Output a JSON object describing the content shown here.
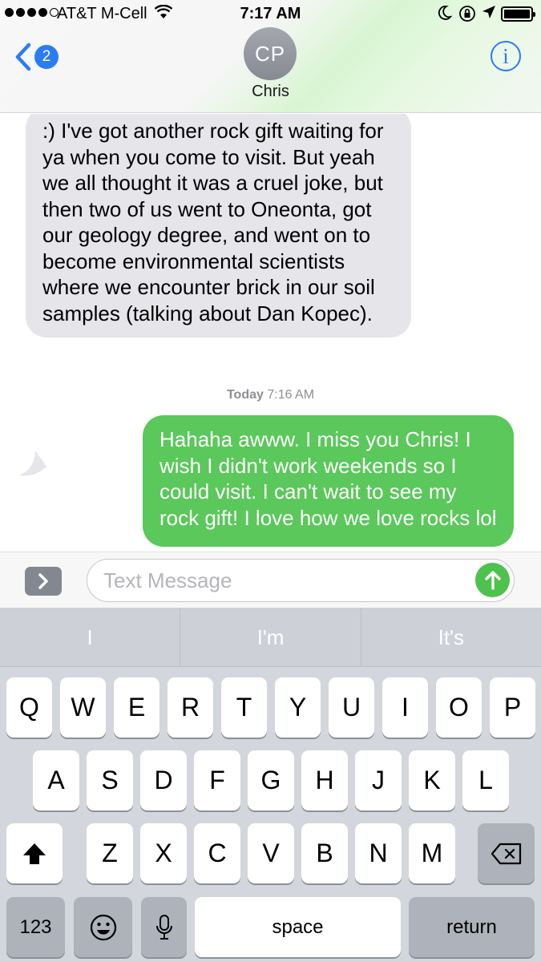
{
  "status_bar": {
    "carrier": "AT&T M-Cell",
    "time": "7:17 AM",
    "signal_bars_filled": 4,
    "signal_bars_total": 5,
    "battery_level": 1.0
  },
  "nav": {
    "back_badge": "2",
    "contact_initials": "CP",
    "contact_name": "Chris",
    "info_icon": "i"
  },
  "conversation": {
    "incoming_message": ":) I've got another rock gift waiting for ya when you come to visit. But yeah we all thought it was a cruel joke, but then two of us went to Oneonta, got our geology degree, and went on to become environmental scientists where we encounter brick in our soil samples (talking about Dan Kopec).",
    "timestamp_day": "Today",
    "timestamp_time": "7:16 AM",
    "outgoing_message": "Hahaha awww. I miss you Chris! I wish I didn't work weekends so I could visit. I can't wait to see my rock gift! I love how we love rocks lol"
  },
  "composer": {
    "placeholder": "Text Message",
    "value": ""
  },
  "keyboard": {
    "suggestions": [
      "I",
      "I'm",
      "It's"
    ],
    "row1": [
      "Q",
      "W",
      "E",
      "R",
      "T",
      "Y",
      "U",
      "I",
      "O",
      "P"
    ],
    "row2": [
      "A",
      "S",
      "D",
      "F",
      "G",
      "H",
      "J",
      "K",
      "L"
    ],
    "row3": [
      "Z",
      "X",
      "C",
      "V",
      "B",
      "N",
      "M"
    ],
    "numbers_label": "123",
    "space_label": "space",
    "return_label": "return"
  },
  "colors": {
    "outgoing_bubble": "#5ac85a",
    "incoming_bubble": "#e5e5ea",
    "accent": "#2a7cf6",
    "send_button": "#4dc24d"
  },
  "icons": {
    "back": "chevron-left-icon",
    "info": "info-icon",
    "apps": "chevron-right-icon",
    "send": "arrow-up-icon",
    "shift": "shift-arrow-icon",
    "delete": "backspace-icon",
    "emoji": "smiley-icon",
    "dictation": "microphone-icon",
    "wifi": "wifi-icon",
    "moon": "moon-icon",
    "rotation_lock": "rotation-lock-icon",
    "location": "location-arrow-icon",
    "battery": "battery-icon"
  }
}
